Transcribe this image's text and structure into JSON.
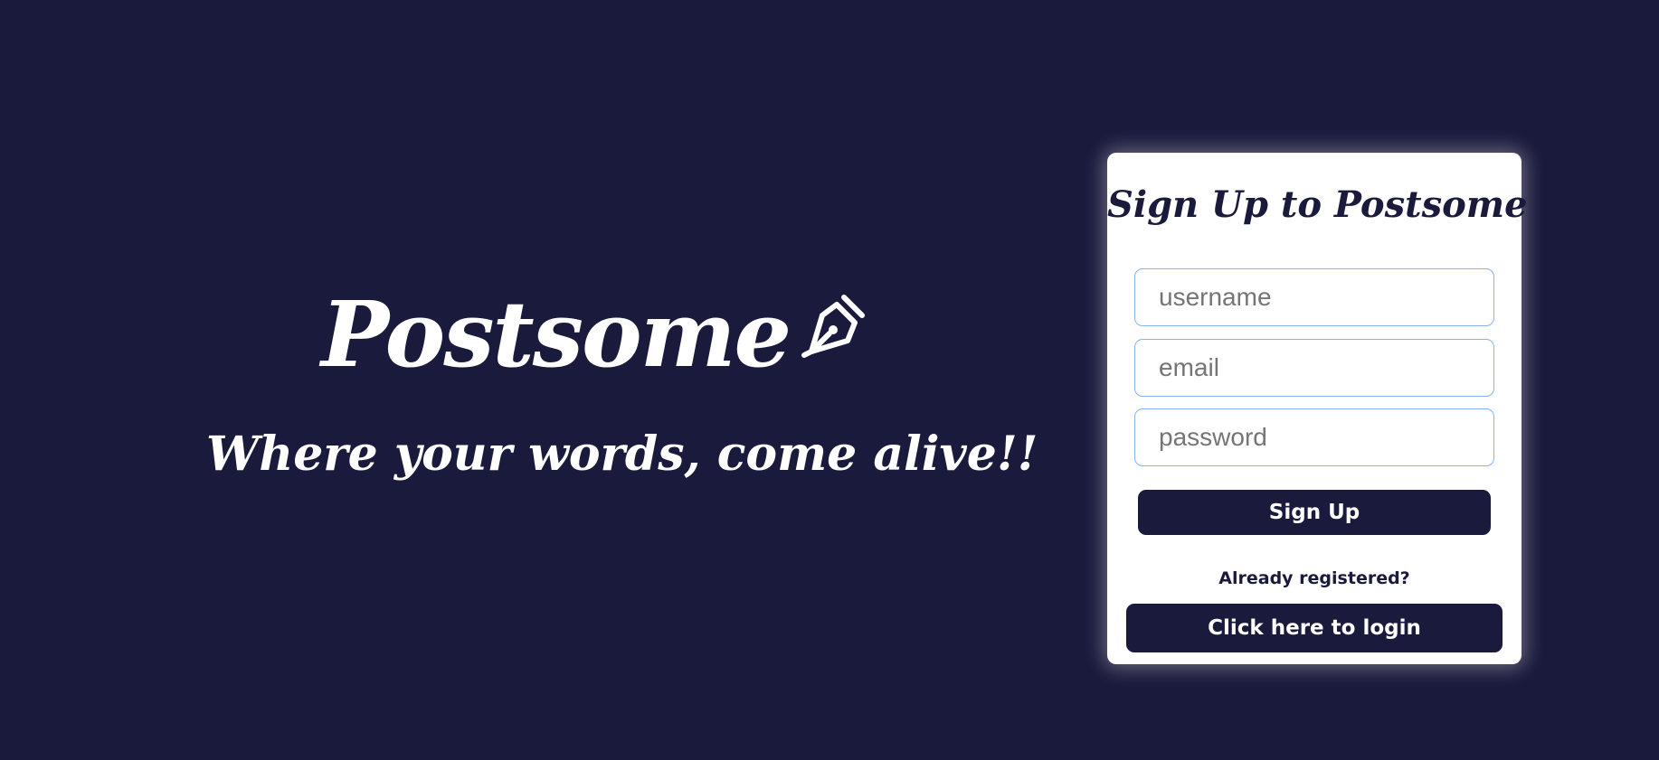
{
  "hero": {
    "brand_title": "Postsome",
    "brand_icon": "pen-nib-icon",
    "tagline": "Where your words, come alive!!"
  },
  "signup": {
    "title": "Sign Up to Postsome",
    "username_placeholder": "username",
    "email_placeholder": "email",
    "password_placeholder": "password",
    "submit_label": "Sign Up",
    "already_registered": "Already registered?",
    "login_label": "Click here to login"
  },
  "colors": {
    "background": "#1a1a3c",
    "card": "#ffffff",
    "field_border": "#8ab0ef",
    "button": "#1a1a3c",
    "button_text": "#ffffff"
  }
}
